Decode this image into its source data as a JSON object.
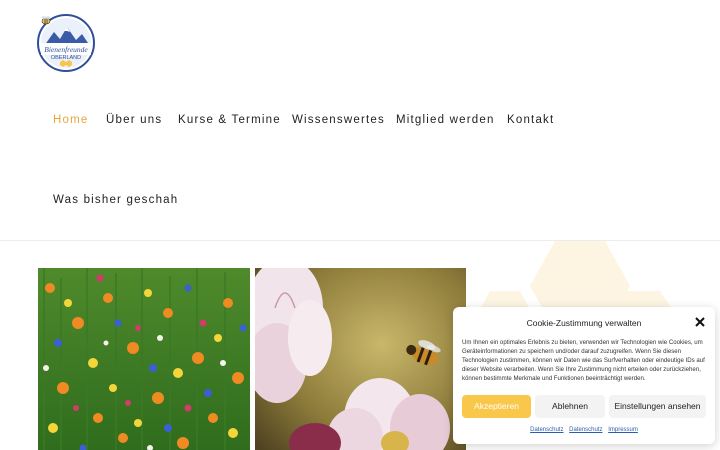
{
  "logo": {
    "line1": "Bienenfreunde",
    "line2": "OBERLAND"
  },
  "nav": {
    "items": [
      {
        "label": "Home",
        "active": true
      },
      {
        "label": "Über uns"
      },
      {
        "label": "Kurse & Termine"
      },
      {
        "label": "Wissenswertes"
      },
      {
        "label": "Mitglied werden"
      },
      {
        "label": "Kontakt"
      },
      {
        "label": "Was bisher geschah"
      }
    ]
  },
  "colors": {
    "accent": "#e8a53c",
    "accept_button": "#f9c74a",
    "link": "#2a5db0"
  },
  "cookie": {
    "title": "Cookie-Zustimmung verwalten",
    "text": "Um Ihnen ein optimales Erlebnis zu bieten, verwenden wir Technologien wie Cookies, um Geräteinformationen zu speichern und/oder darauf zuzugreifen. Wenn Sie diesen Technologien zustimmen, können wir Daten wie das Surfverhalten oder eindeutige IDs auf dieser Website verarbeiten. Wenn Sie Ihre Zustimmung nicht erteilen oder zurückziehen, können bestimmte Merkmale und Funktionen beeinträchtigt werden.",
    "accept": "Akzeptieren",
    "deny": "Ablehnen",
    "settings": "Einstellungen ansehen",
    "links": [
      "Datenschutz",
      "Datenschutz",
      "Impressum"
    ]
  }
}
